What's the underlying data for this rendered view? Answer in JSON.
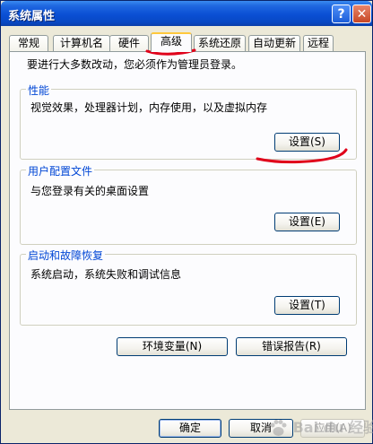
{
  "window": {
    "title": "系统属性",
    "help_symbol": "?",
    "close_symbol": "✕"
  },
  "tabs": [
    {
      "label": "常规"
    },
    {
      "label": "计算机名"
    },
    {
      "label": "硬件"
    },
    {
      "label": "高级",
      "active": true
    },
    {
      "label": "系统还原"
    },
    {
      "label": "自动更新"
    },
    {
      "label": "远程"
    }
  ],
  "panel": {
    "intro": "要进行大多数改动，您必须作为管理员登录。",
    "groups": {
      "performance": {
        "title": "性能",
        "description": "视觉效果，处理器计划，内存使用，以及虚拟内存",
        "button": "设置(S)"
      },
      "user_profiles": {
        "title": "用户配置文件",
        "description": "与您登录有关的桌面设置",
        "button": "设置(E)"
      },
      "startup_recovery": {
        "title": "启动和故障恢复",
        "description": "系统启动，系统失败和调试信息",
        "button": "设置(T)"
      }
    },
    "env_button": "环境变量(N)",
    "error_report_button": "错误报告(R)"
  },
  "footer": {
    "ok": "确定",
    "cancel": "取消",
    "apply": "应用(A)"
  },
  "watermark": {
    "text": "Bai du 经验",
    "icon": "paw-icon"
  },
  "annotation_color": "#e0001a"
}
